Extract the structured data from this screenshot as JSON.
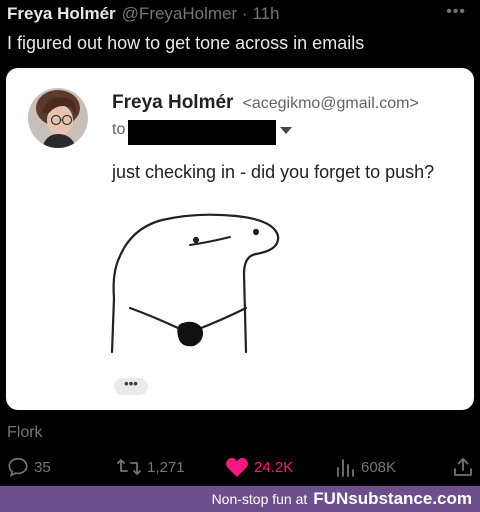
{
  "tweet": {
    "author_name": "Freya Holmér",
    "author_handle": "@FreyaHolmer",
    "separator": "·",
    "time": "11h",
    "more_icon": "more-dots-icon",
    "text": "I figured out how to get tone across in emails"
  },
  "email": {
    "sender_name": "Freya Holmér",
    "sender_email": "<acegikmo@gmail.com>",
    "to_label": "to",
    "body": "just checking in - did you forget to push?",
    "ellipsis": "•••"
  },
  "image_caption": "Flork",
  "actions": {
    "replies": "35",
    "retweets": "1,271",
    "likes": "24.2K",
    "views": "608K",
    "like_color": "#f91880"
  },
  "footer": {
    "tagline": "Non-stop fun at",
    "brand": "FUNsubstance.com",
    "background": "#6c4f8c"
  }
}
